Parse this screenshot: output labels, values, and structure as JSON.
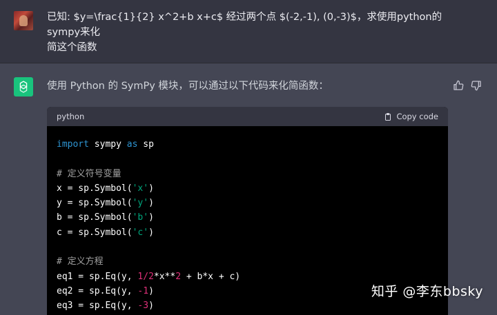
{
  "user": {
    "message_line1": "已知: $y=\\frac{1}{2} x^2+b x+c$ 经过两个点 $(-2,-1), (0,-3)$，求使用python的sympy来化",
    "message_line2": "简这个函数"
  },
  "assistant": {
    "intro": "使用 Python 的 SymPy 模块，可以通过以下代码来化简函数：",
    "code": {
      "language": "python",
      "copy_label": "Copy code",
      "line1": {
        "kw1": "import",
        "mid": " sympy ",
        "kw2": "as",
        "end": " sp"
      },
      "comment1": "# 定义符号变量",
      "sym_x": {
        "pre": "x = sp.Symbol(",
        "arg": "'x'",
        "post": ")"
      },
      "sym_y": {
        "pre": "y = sp.Symbol(",
        "arg": "'y'",
        "post": ")"
      },
      "sym_b": {
        "pre": "b = sp.Symbol(",
        "arg": "'b'",
        "post": ")"
      },
      "sym_c": {
        "pre": "c = sp.Symbol(",
        "arg": "'c'",
        "post": ")"
      },
      "comment2": "# 定义方程",
      "eq1": {
        "pre": "eq1 = sp.Eq(y, ",
        "n1": "1",
        "op": "/",
        "n2": "2",
        "mid": "*x**",
        "n3": "2",
        "post": " + b*x + c)"
      },
      "eq2": {
        "pre": "eq2 = sp.Eq(y, ",
        "n1": "-1",
        "post": ")"
      },
      "eq3": {
        "pre": "eq3 = sp.Eq(y, ",
        "n1": "-3",
        "post": ")"
      }
    }
  },
  "watermark": "知乎 @李东bbsky",
  "colors": {
    "keyword": "#2e95d3",
    "string": "#00a67d",
    "number": "#df3079",
    "comment": "#a0a0a0",
    "gpt_green": "#19c37d"
  }
}
